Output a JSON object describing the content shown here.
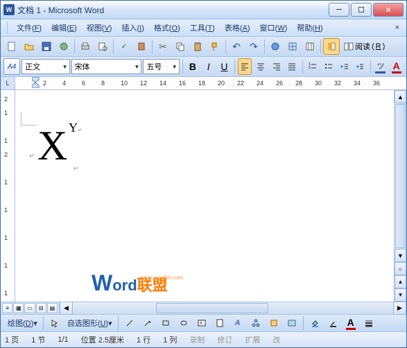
{
  "titlebar": {
    "title": "文档 1 - Microsoft Word",
    "app_icon": "W"
  },
  "menu": {
    "file": "文件",
    "file_a": "F",
    "edit": "编辑",
    "edit_a": "E",
    "view": "视图",
    "view_a": "V",
    "insert": "插入",
    "insert_a": "I",
    "format": "格式",
    "format_a": "O",
    "tools": "工具",
    "tools_a": "T",
    "table": "表格",
    "table_a": "A",
    "window": "窗口",
    "window_a": "W",
    "help": "帮助",
    "help_a": "H"
  },
  "toolbar": {
    "reading_label": "阅读",
    "reading_accel": "R"
  },
  "format": {
    "aa_label": "A4",
    "style": "正文",
    "font": "宋体",
    "size": "五号",
    "bold": "B",
    "italic": "I",
    "underline": "U"
  },
  "ruler": {
    "ticks": [
      "2",
      "4",
      "6",
      "8",
      "10",
      "12",
      "14",
      "16",
      "18",
      "20",
      "22",
      "24",
      "26",
      "28",
      "30",
      "32",
      "34",
      "36"
    ]
  },
  "vruler": {
    "ticks": [
      "2",
      "1",
      "",
      "1",
      "2",
      "",
      "1",
      "",
      "1",
      "",
      "1",
      "",
      "1",
      "",
      "1"
    ]
  },
  "document": {
    "base": "X",
    "sup": "Y"
  },
  "watermark": {
    "w": "W",
    "ord": "ord",
    "lianmeng": "联盟",
    "url": "www.wordlm.com"
  },
  "drawbar": {
    "label": "绘图",
    "label_a": "D",
    "autoshape": "自选图形",
    "autoshape_a": "U"
  },
  "status": {
    "page": "1 页",
    "sec": "1 节",
    "pages": "1/1",
    "pos": "位置 2.5厘米",
    "line": "1 行",
    "col": "1 列",
    "rec": "录制",
    "rev": "修订",
    "ext": "扩展",
    "ovw": "改"
  }
}
